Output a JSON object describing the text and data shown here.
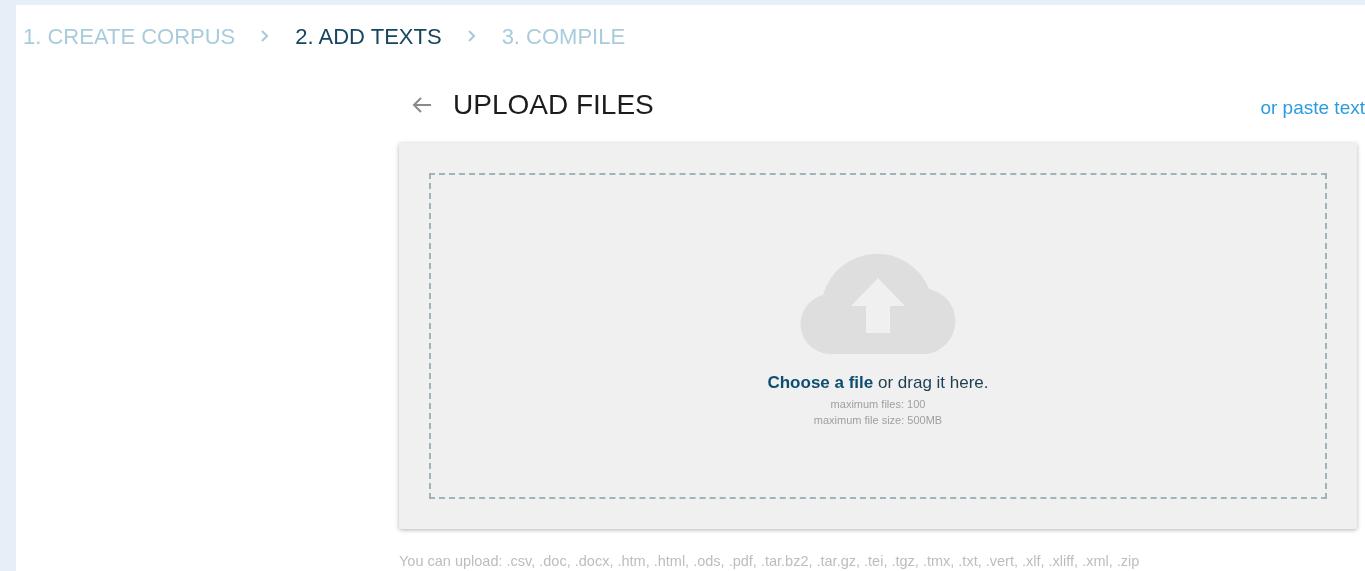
{
  "steps": [
    {
      "label": "1. CREATE CORPUS",
      "selected": false
    },
    {
      "label": "2. ADD TEXTS",
      "selected": true
    },
    {
      "label": "3. COMPILE",
      "selected": false
    }
  ],
  "upload": {
    "title": "UPLOAD FILES",
    "paste_link": "or paste text",
    "prompt": "**Choose a file** or drag it here.",
    "limits": [
      "maximum files: 100",
      "maximum file size: 500MB"
    ]
  },
  "formats_note": "You can upload: .csv, .doc, .docx, .htm, .html, .ods, .pdf, .tar.bz2, .tar.gz, .tei, .tgz, .tmx, .txt, .vert, .xlf, .xliff, .xml, .zip"
}
